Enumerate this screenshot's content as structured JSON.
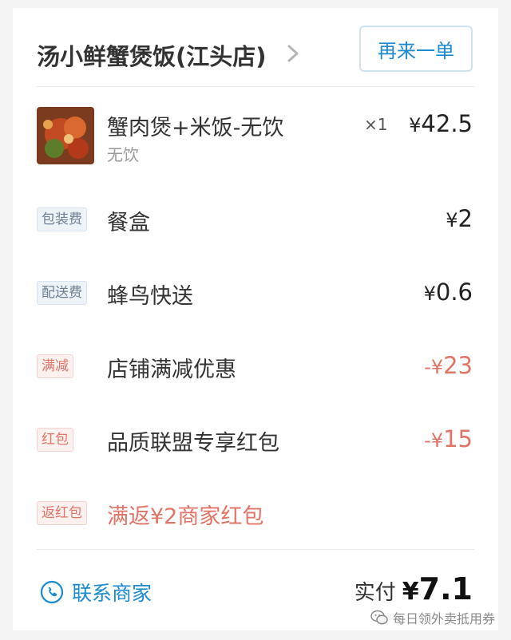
{
  "header": {
    "shop_name": "汤小鲜蟹煲饭(江头店)",
    "reorder_label": "再来一单"
  },
  "item": {
    "name": "蟹肉煲+米饭-无饮",
    "sub": "无饮",
    "qty": "×1",
    "price_symbol": "¥",
    "price_value": "42.5"
  },
  "rows": [
    {
      "tag": "包装费",
      "label": "餐盒",
      "symbol": "¥",
      "value": "2"
    },
    {
      "tag": "配送费",
      "label": "蜂鸟快送",
      "symbol": "¥",
      "value": "0.6"
    },
    {
      "tag": "满减",
      "label": "店铺满减优惠",
      "symbol": "-¥",
      "value": "23"
    },
    {
      "tag": "红包",
      "label": "品质联盟专享红包",
      "symbol": "-¥",
      "value": "15"
    },
    {
      "tag": "返红包",
      "label": "满返¥2商家红包"
    }
  ],
  "footer": {
    "contact_label": "联系商家",
    "paid_label": "实付",
    "paid_symbol": "¥",
    "paid_value": "7.1"
  },
  "watermark": "每日领外卖抵用券",
  "colors": {
    "accent_blue": "#1a8ad1",
    "discount_red": "#e07466",
    "tag_gray_bg": "#eef3f8",
    "tag_red_bg": "#fdf1f0"
  },
  "icons": {
    "header_chevron": "chevron-right-icon",
    "contact": "phone-icon",
    "watermark": "wechat-icon"
  }
}
